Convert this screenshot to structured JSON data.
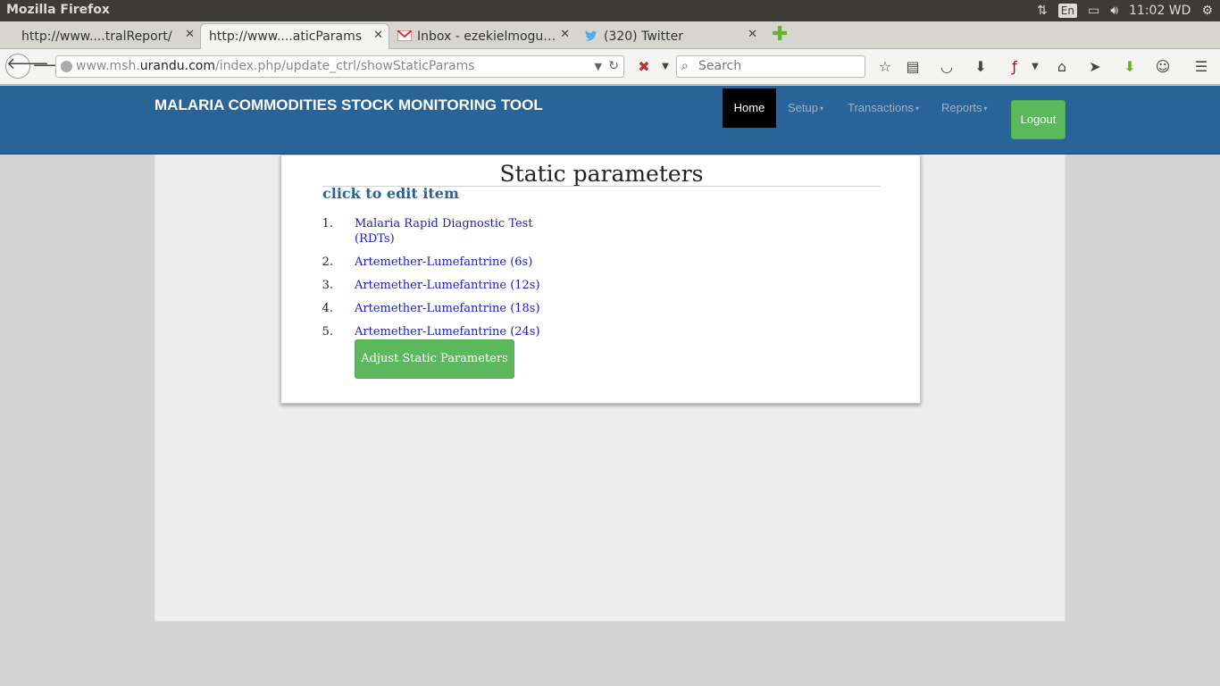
{
  "os": {
    "app_title": "Mozilla Firefox",
    "lang": "En",
    "clock": "11:02 WD"
  },
  "tabs": [
    {
      "label": "http://www....tralReport/",
      "active": false
    },
    {
      "label": "http://www....aticParams",
      "active": true
    },
    {
      "label": "Inbox - ezekielmogu…",
      "active": false
    },
    {
      "label": "(320) Twitter",
      "active": false
    }
  ],
  "browser": {
    "url_prefix": "www.msh.",
    "url_host": "urandu.com",
    "url_path": "/index.php/update_ctrl/showStaticParams",
    "search_placeholder": "Search"
  },
  "app": {
    "brand": "MALARIA COMMODITIES STOCK MONITORING TOOL",
    "nav": {
      "home": "Home",
      "setup": "Setup",
      "transactions": "Transactions",
      "reports": "Reports",
      "logout": "Logout"
    }
  },
  "card": {
    "title": "Static parameters",
    "subtitle": "click to edit item",
    "items": [
      {
        "num": "1.",
        "label": "Malaria Rapid Diagnostic Test (RDTs)"
      },
      {
        "num": "2.",
        "label": "Artemether-Lumefantrine (6s)"
      },
      {
        "num": "3.",
        "label": "Artemether-Lumefantrine (12s)"
      },
      {
        "num": "4.",
        "label": "Artemether-Lumefantrine (18s)"
      },
      {
        "num": "5.",
        "label": "Artemether-Lumefantrine (24s)"
      }
    ],
    "adjust_button": "Adjust Static Parameters"
  },
  "colors": {
    "header_blue": "#296498",
    "button_green": "#5cb85c",
    "link_blue": "#1b20c6"
  }
}
